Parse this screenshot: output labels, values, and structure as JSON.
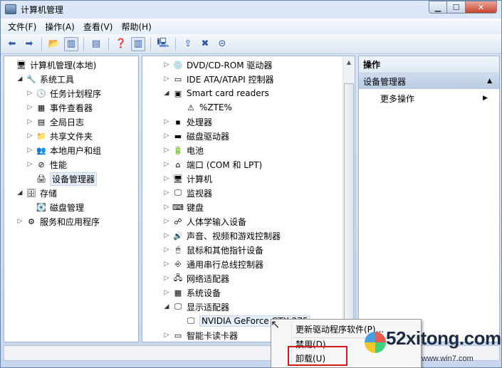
{
  "window": {
    "title": "计算机管理"
  },
  "menu": [
    "文件(F)",
    "操作(A)",
    "查看(V)",
    "帮助(H)"
  ],
  "left_tree": [
    {
      "label": "计算机管理(本地)",
      "indent": 0,
      "expander": "",
      "icon": "computer-icon",
      "glyph": "🖥"
    },
    {
      "label": "系统工具",
      "indent": 1,
      "expander": "open",
      "icon": "tools-icon",
      "glyph": "🔧"
    },
    {
      "label": "任务计划程序",
      "indent": 2,
      "expander": "closed",
      "icon": "clock-icon",
      "glyph": "🕓"
    },
    {
      "label": "事件查看器",
      "indent": 2,
      "expander": "closed",
      "icon": "event-viewer-icon",
      "glyph": "▦"
    },
    {
      "label": "全局日志",
      "indent": 2,
      "expander": "closed",
      "icon": "log-icon",
      "glyph": "▤"
    },
    {
      "label": "共享文件夹",
      "indent": 2,
      "expander": "closed",
      "icon": "shared-folder-icon",
      "glyph": "📁"
    },
    {
      "label": "本地用户和组",
      "indent": 2,
      "expander": "closed",
      "icon": "users-icon",
      "glyph": "👥"
    },
    {
      "label": "性能",
      "indent": 2,
      "expander": "closed",
      "icon": "performance-icon",
      "glyph": "⊘"
    },
    {
      "label": "设备管理器",
      "indent": 2,
      "expander": "",
      "icon": "device-manager-icon",
      "glyph": "🖨",
      "selected": true
    },
    {
      "label": "存储",
      "indent": 1,
      "expander": "open",
      "icon": "storage-icon",
      "glyph": "🗄"
    },
    {
      "label": "磁盘管理",
      "indent": 2,
      "expander": "",
      "icon": "disk-management-icon",
      "glyph": "💽"
    },
    {
      "label": "服务和应用程序",
      "indent": 1,
      "expander": "closed",
      "icon": "services-icon",
      "glyph": "⚙"
    }
  ],
  "device_tree": [
    {
      "label": "DVD/CD-ROM 驱动器",
      "indent": 0,
      "expander": "closed",
      "icon": "dvd-icon",
      "glyph": "💿"
    },
    {
      "label": "IDE ATA/ATAPI 控制器",
      "indent": 0,
      "expander": "closed",
      "icon": "ide-controller-icon",
      "glyph": "▭"
    },
    {
      "label": "Smart card readers",
      "indent": 0,
      "expander": "open",
      "icon": "smart-card-icon",
      "glyph": "▣"
    },
    {
      "label": "%ZTE%",
      "indent": 1,
      "expander": "",
      "icon": "warning-device-icon",
      "glyph": "⚠"
    },
    {
      "label": "处理器",
      "indent": 0,
      "expander": "closed",
      "icon": "processor-icon",
      "glyph": "▪"
    },
    {
      "label": "磁盘驱动器",
      "indent": 0,
      "expander": "closed",
      "icon": "disk-drive-icon",
      "glyph": "▬"
    },
    {
      "label": "电池",
      "indent": 0,
      "expander": "closed",
      "icon": "battery-icon",
      "glyph": "🔋"
    },
    {
      "label": "端口 (COM 和 LPT)",
      "indent": 0,
      "expander": "closed",
      "icon": "port-icon",
      "glyph": "⌂"
    },
    {
      "label": "计算机",
      "indent": 0,
      "expander": "closed",
      "icon": "computer-icon",
      "glyph": "🖥"
    },
    {
      "label": "监视器",
      "indent": 0,
      "expander": "closed",
      "icon": "monitor-icon",
      "glyph": "🖵"
    },
    {
      "label": "键盘",
      "indent": 0,
      "expander": "closed",
      "icon": "keyboard-icon",
      "glyph": "⌨"
    },
    {
      "label": "人体学输入设备",
      "indent": 0,
      "expander": "closed",
      "icon": "hid-icon",
      "glyph": "☍"
    },
    {
      "label": "声音、视频和游戏控制器",
      "indent": 0,
      "expander": "closed",
      "icon": "sound-icon",
      "glyph": "🔊"
    },
    {
      "label": "鼠标和其他指针设备",
      "indent": 0,
      "expander": "closed",
      "icon": "mouse-icon",
      "glyph": "🖱"
    },
    {
      "label": "通用串行总线控制器",
      "indent": 0,
      "expander": "closed",
      "icon": "usb-icon",
      "glyph": "⎆"
    },
    {
      "label": "网络适配器",
      "indent": 0,
      "expander": "closed",
      "icon": "network-adapter-icon",
      "glyph": "🖧"
    },
    {
      "label": "系统设备",
      "indent": 0,
      "expander": "closed",
      "icon": "system-device-icon",
      "glyph": "▦"
    },
    {
      "label": "显示适配器",
      "indent": 0,
      "expander": "open",
      "icon": "display-adapter-icon",
      "glyph": "🖵"
    },
    {
      "label": "NVIDIA GeForce GTX 275",
      "indent": 1,
      "expander": "",
      "icon": "display-adapter-icon",
      "glyph": "🖵",
      "selected": true
    },
    {
      "label": "智能卡读卡器",
      "indent": 0,
      "expander": "closed",
      "icon": "card-reader-icon",
      "glyph": "▭"
    }
  ],
  "actions": {
    "header": "操作",
    "section": "设备管理器",
    "more": "更多操作"
  },
  "context_menu": {
    "items": [
      "更新驱动程序软件(P)...",
      "禁用(D)",
      "卸载(U)"
    ]
  },
  "watermark": {
    "text": "52xitong.com",
    "sub": "www.win7.com"
  }
}
